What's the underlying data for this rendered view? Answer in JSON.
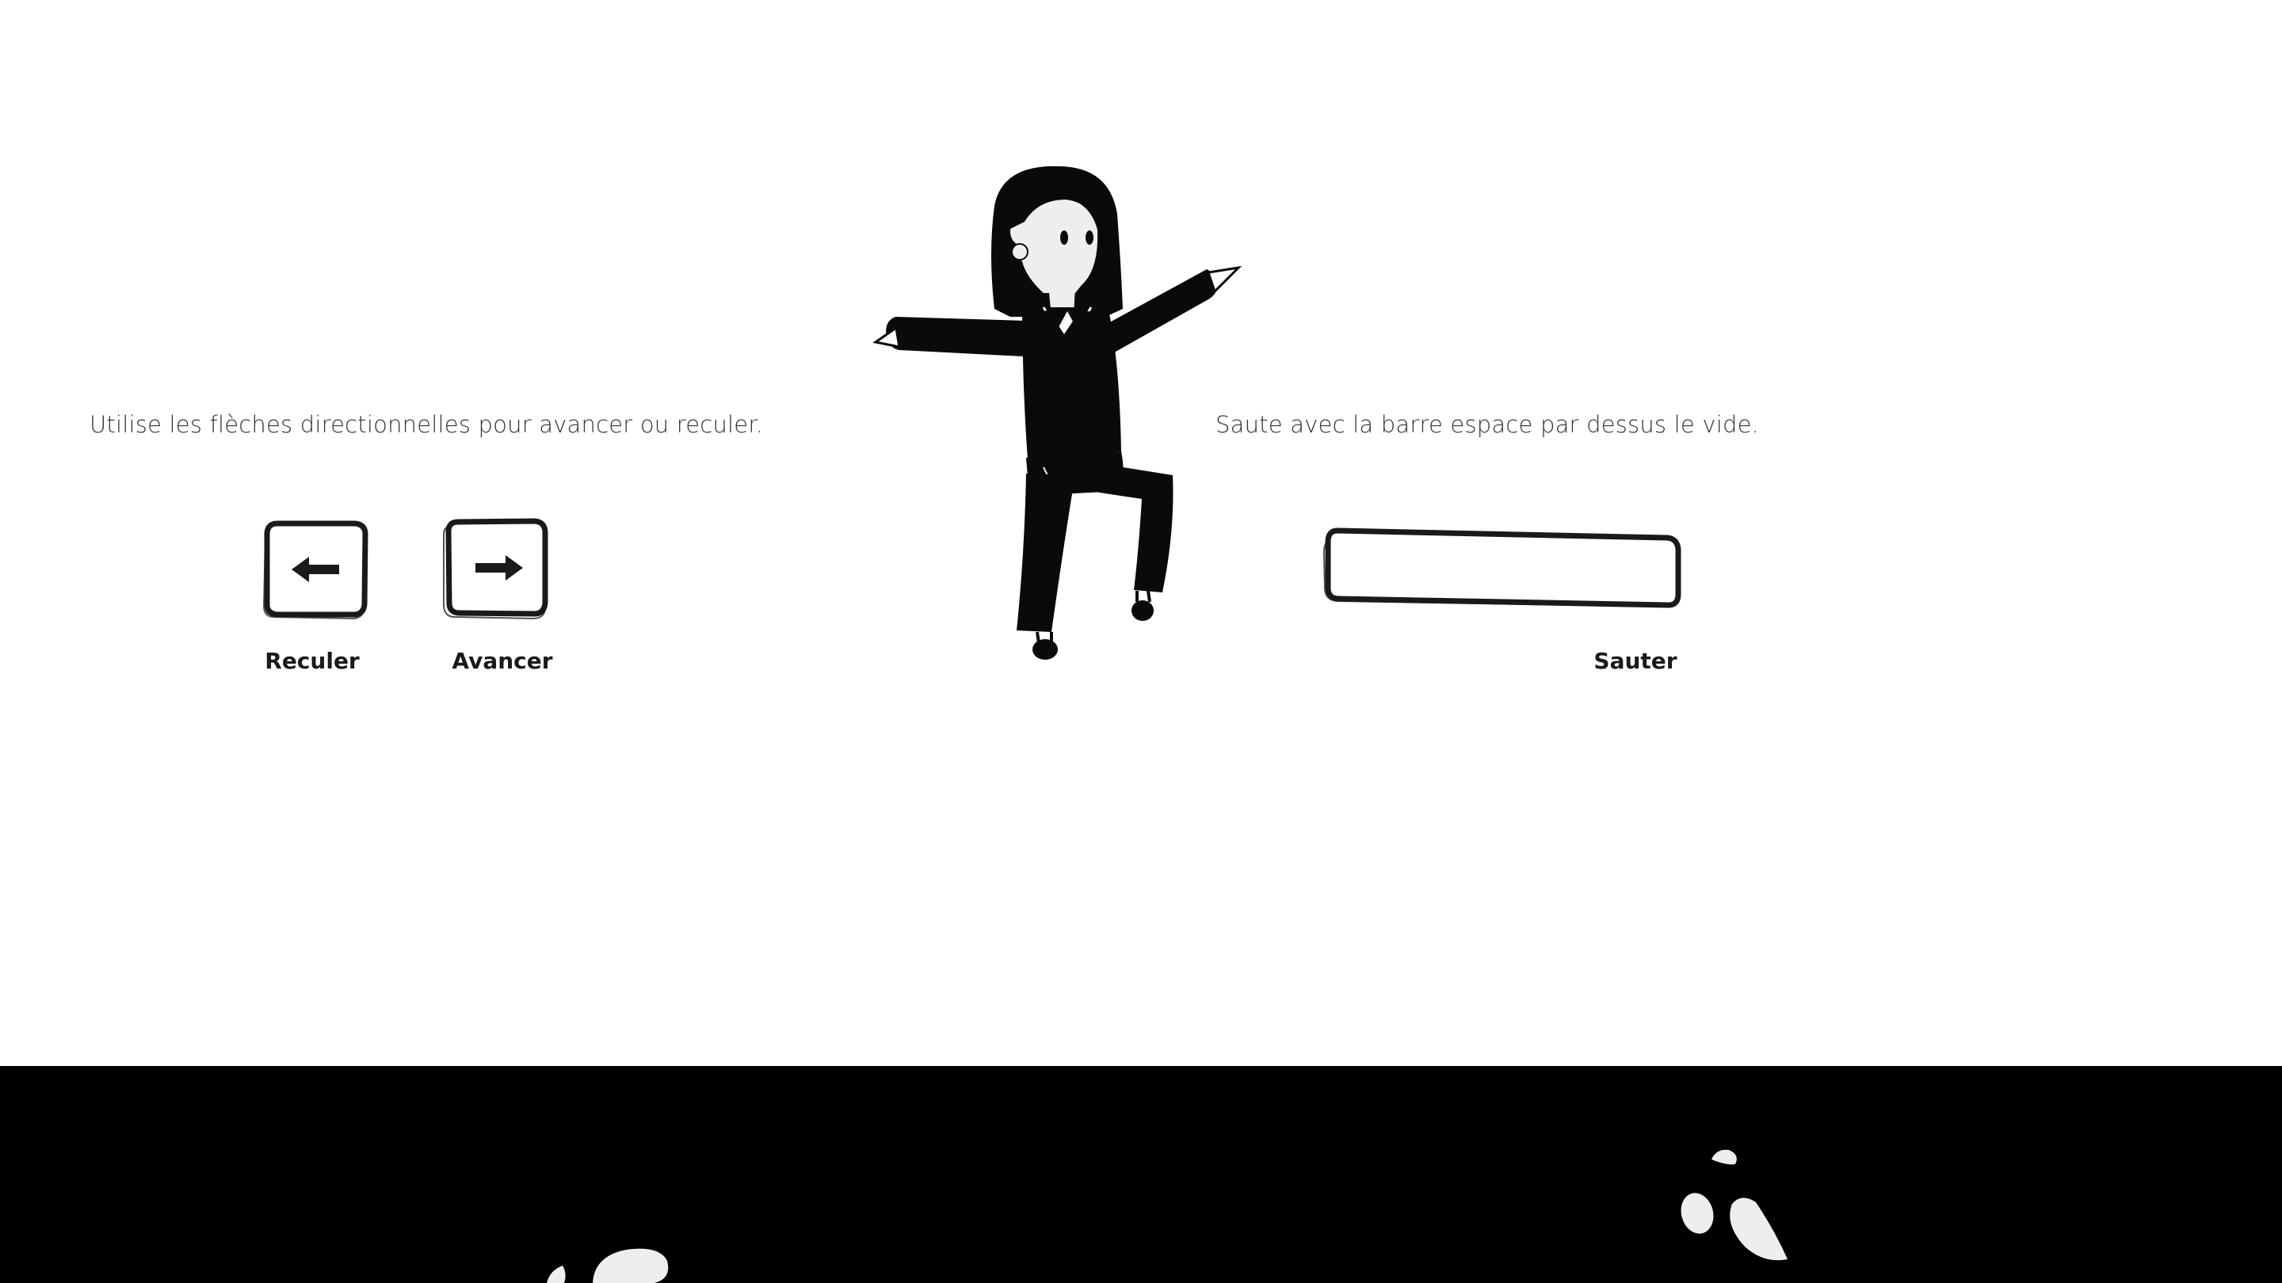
{
  "instructions": {
    "move": "Utilise les flèches directionnelles pour avancer ou reculer.",
    "jump": "Saute avec la barre espace par dessus le vide."
  },
  "controls": {
    "left_key": {
      "icon": "arrow-left-icon",
      "label": "Reculer"
    },
    "right_key": {
      "icon": "arrow-right-icon",
      "label": "Avancer"
    },
    "space_key": {
      "icon": "spacebar-icon",
      "label": "Sauter"
    }
  },
  "colors": {
    "background": "#ffffff",
    "ground": "#000000",
    "ink": "#1a1a1a"
  }
}
